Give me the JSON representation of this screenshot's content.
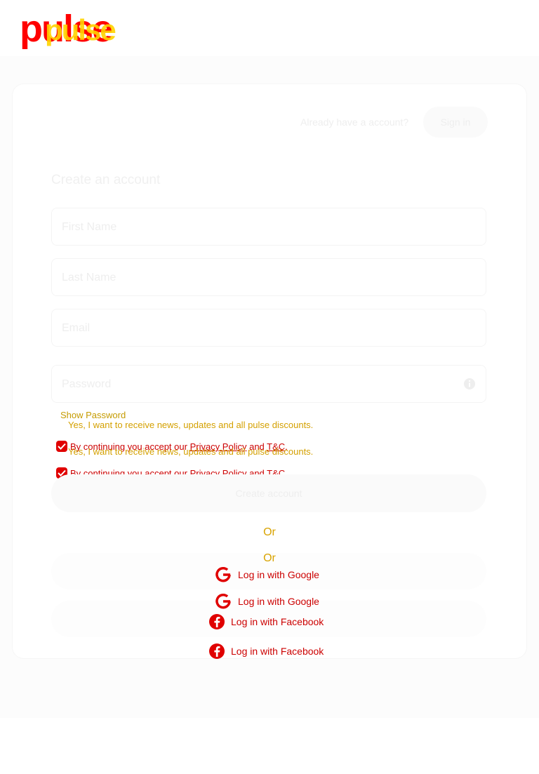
{
  "logo": {
    "text": "pulse"
  },
  "header": {
    "already_text": "Already have a account?",
    "signin_label": "Sign in"
  },
  "form": {
    "title": "Create an account",
    "first_name_placeholder": "First Name",
    "last_name_placeholder": "Last Name",
    "email_placeholder": "Email",
    "password_placeholder": "Password",
    "show_password": "Show Password",
    "news_text": "Yes, I want to receive news, updates and all pulse discounts.",
    "terms_prefix": "By continuing you accept our ",
    "privacy_link": "Privacy Policy",
    "terms_and": " and ",
    "tc_link": "T&C",
    "terms_suffix": ".",
    "create_label": "Create account"
  },
  "divider": {
    "or": "Or"
  },
  "social": {
    "google_label": "Log in with Google",
    "facebook_label": "Log in with Facebook"
  },
  "colors": {
    "accent_red": "#e00000",
    "accent_yellow": "#ffd400",
    "facebook_blue": "#1877f2"
  }
}
